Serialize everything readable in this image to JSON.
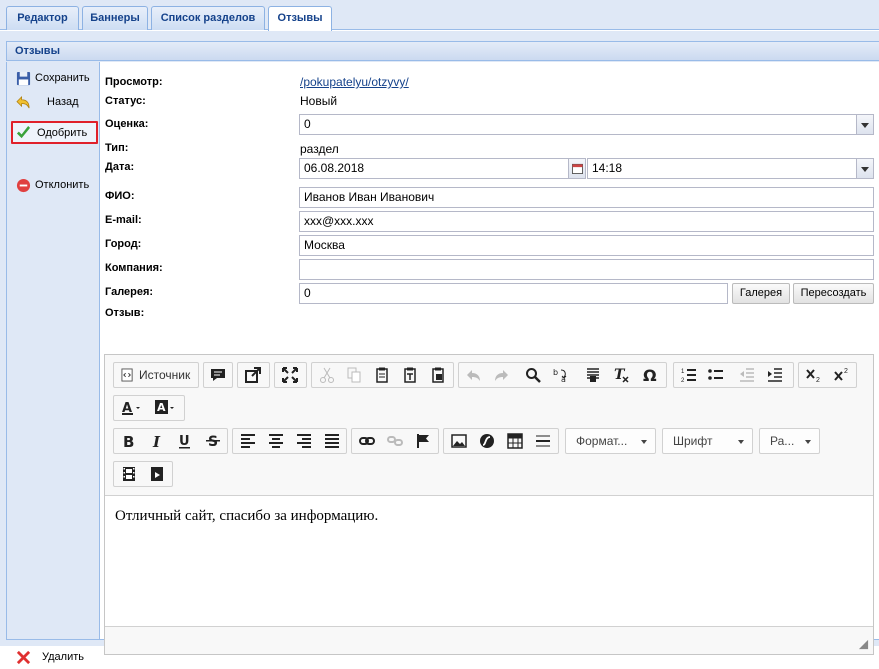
{
  "tabs": [
    {
      "label": "Редактор"
    },
    {
      "label": "Баннеры"
    },
    {
      "label": "Список разделов"
    },
    {
      "label": "Отзывы"
    }
  ],
  "panel": {
    "title": "Отзывы"
  },
  "sidebar": {
    "save_label": "Сохранить",
    "back_label": "Назад",
    "approve_label": "Одобрить",
    "reject_label": "Отклонить",
    "delete_label": "Удалить"
  },
  "form": {
    "preview_label": "Просмотр:",
    "preview_link": "/pokupatelyu/otzyvy/",
    "status_label": "Статус:",
    "status_value": "Новый",
    "rating_label": "Оценка:",
    "rating_value": "0",
    "type_label": "Тип:",
    "type_value": "раздел",
    "date_label": "Дата:",
    "date_value": "06.08.2018",
    "time_value": "14:18",
    "fio_label": "ФИО:",
    "fio_value": "Иванов Иван Иванович",
    "email_label": "E-mail:",
    "email_value": "xxx@xxx.xxx",
    "city_label": "Город:",
    "city_value": "Москва",
    "company_label": "Компания:",
    "company_value": "",
    "gallery_label": "Галерея:",
    "gallery_value": "0",
    "gallery_button": "Галерея",
    "recreate_button": "Пересоздать",
    "review_label": "Отзыв:"
  },
  "editor": {
    "source_label": "Источник",
    "format_label": "Формат...",
    "font_label": "Шрифт",
    "size_label": "Ра...",
    "content": "Отличный сайт, спасибо за информацию."
  },
  "colors": {
    "accent": "#15428b",
    "frame": "#dfe8f6",
    "border": "#99bbe8",
    "highlight": "#e0202a",
    "link": "#15428b"
  }
}
